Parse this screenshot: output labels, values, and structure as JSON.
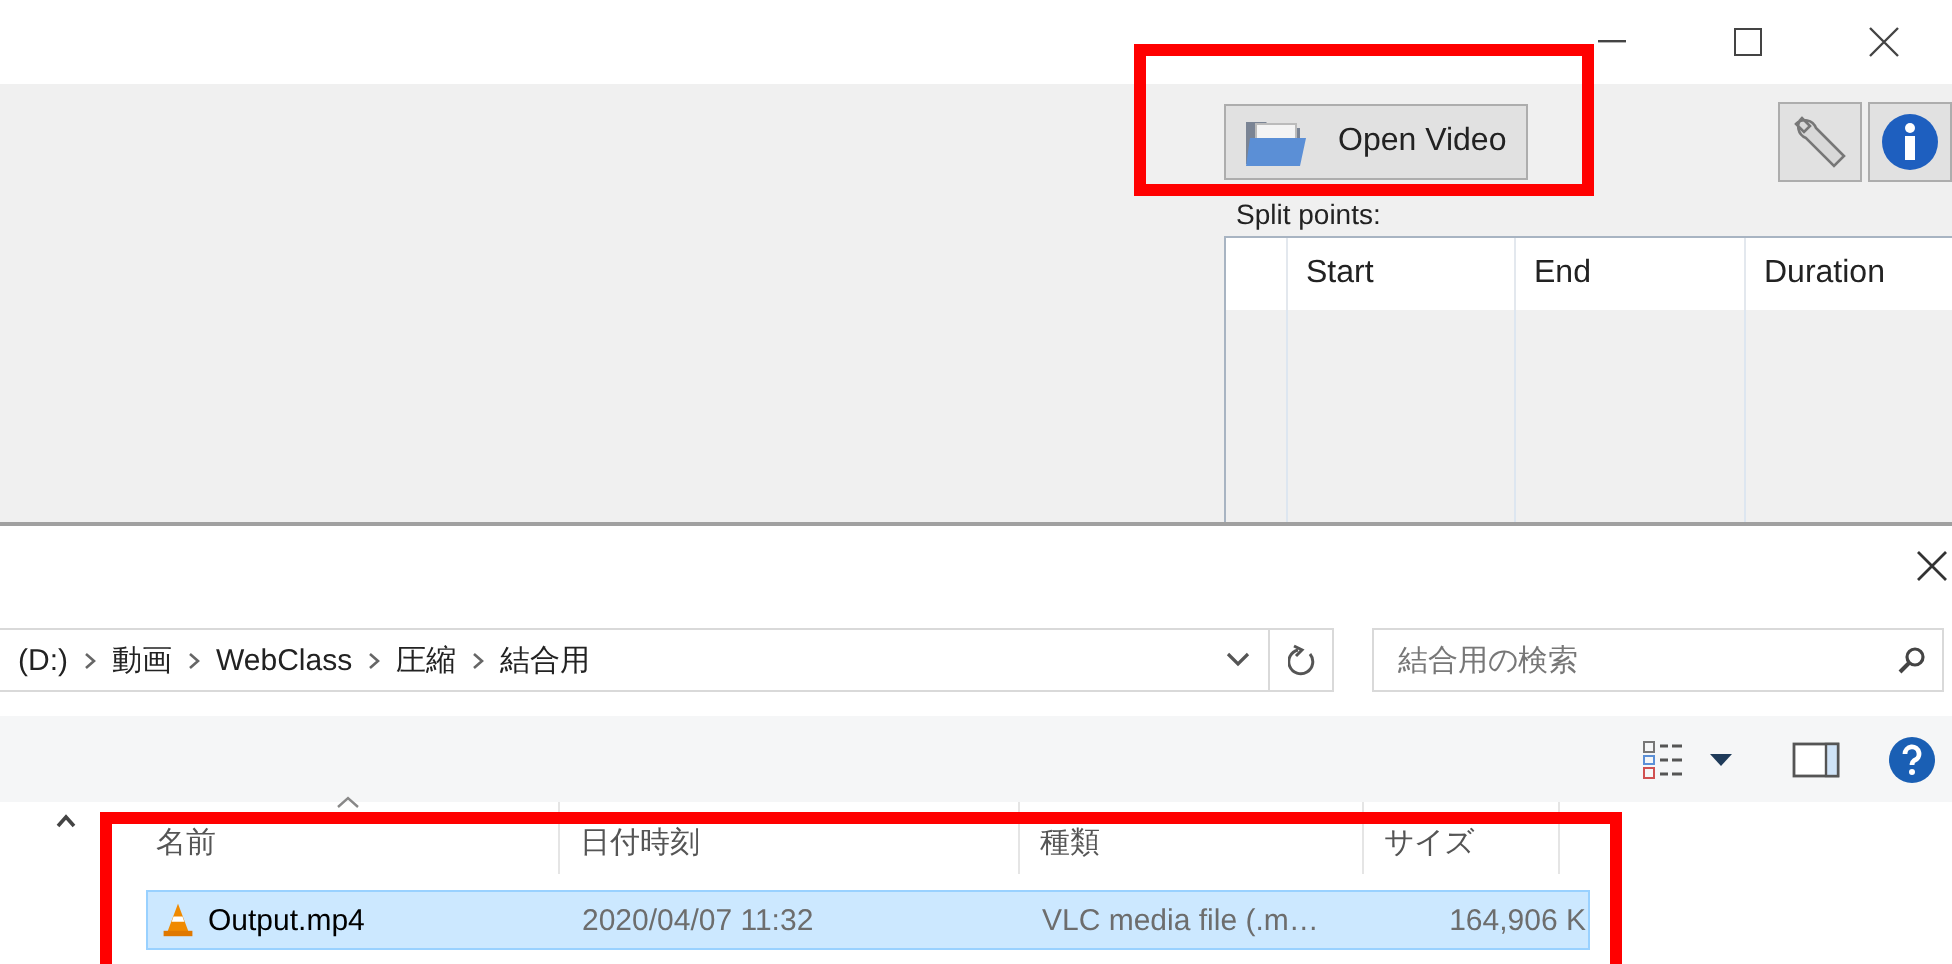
{
  "splitter": {
    "open_button": "Open Video",
    "split_points_label": "Split points:",
    "table": {
      "columns": [
        "Start",
        "End",
        "Duration"
      ]
    }
  },
  "dialog": {
    "breadcrumb": [
      "(D:)",
      "動画",
      "WebClass",
      "圧縮",
      "結合用"
    ],
    "search": {
      "placeholder": "結合用の検索"
    },
    "file_list": {
      "columns": [
        "名前",
        "日付時刻",
        "種類",
        "サイズ"
      ],
      "rows": [
        {
          "name": "Output.mp4",
          "date": "2020/04/07 11:32",
          "type": "VLC media file (.m…",
          "size": "164,906 K",
          "selected": true
        }
      ]
    }
  }
}
